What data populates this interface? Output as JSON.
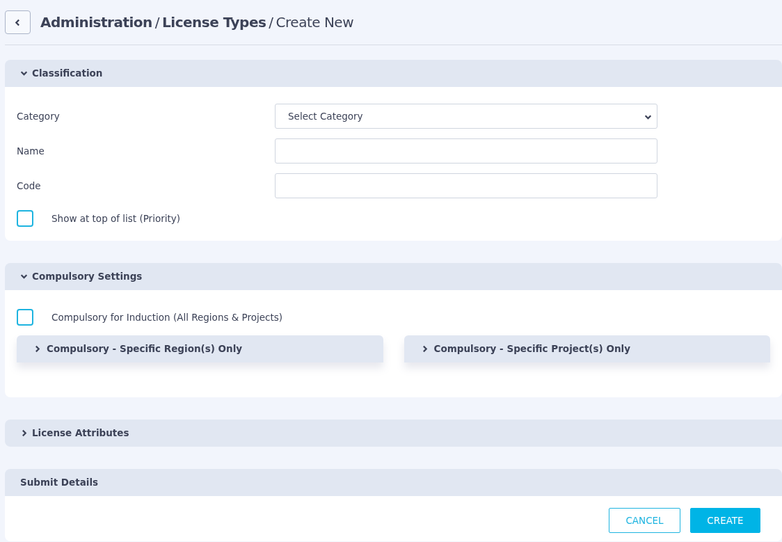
{
  "header": {
    "breadcrumb": [
      {
        "text": "Administration",
        "kind": "link"
      },
      {
        "text": "/",
        "kind": "separator"
      },
      {
        "text": "License Types",
        "kind": "link"
      },
      {
        "text": "/",
        "kind": "separator"
      },
      {
        "text": "Create New",
        "kind": "current"
      }
    ]
  },
  "sections": [
    {
      "kind": "collapsible",
      "title": "Classification",
      "expanded": true,
      "fields": [
        {
          "kind": "select",
          "label": "Category",
          "value": "Select Category"
        },
        {
          "kind": "text",
          "label": "Name"
        },
        {
          "kind": "text",
          "label": "Code"
        },
        {
          "kind": "checkbox",
          "label": "Show at top of list (Priority)",
          "checked": false
        }
      ]
    },
    {
      "kind": "collapsible",
      "title": "Compulsory Settings",
      "expanded": true,
      "fields": [
        {
          "kind": "checkbox",
          "label": "Compulsory for Induction (All Regions & Projects)",
          "checked": false
        }
      ],
      "subpanels": [
        {
          "title": "Compulsory - Specific Region(s) Only",
          "expanded": false
        },
        {
          "title": "Compulsory - Specific Project(s) Only",
          "expanded": false
        }
      ]
    },
    {
      "kind": "collapsible",
      "title": "License Attributes",
      "expanded": false
    },
    {
      "kind": "plain",
      "title": "Submit Details",
      "buttons": [
        {
          "label": "CANCEL",
          "kind": "outline"
        },
        {
          "label": "CREATE",
          "kind": "primary"
        }
      ]
    }
  ]
}
